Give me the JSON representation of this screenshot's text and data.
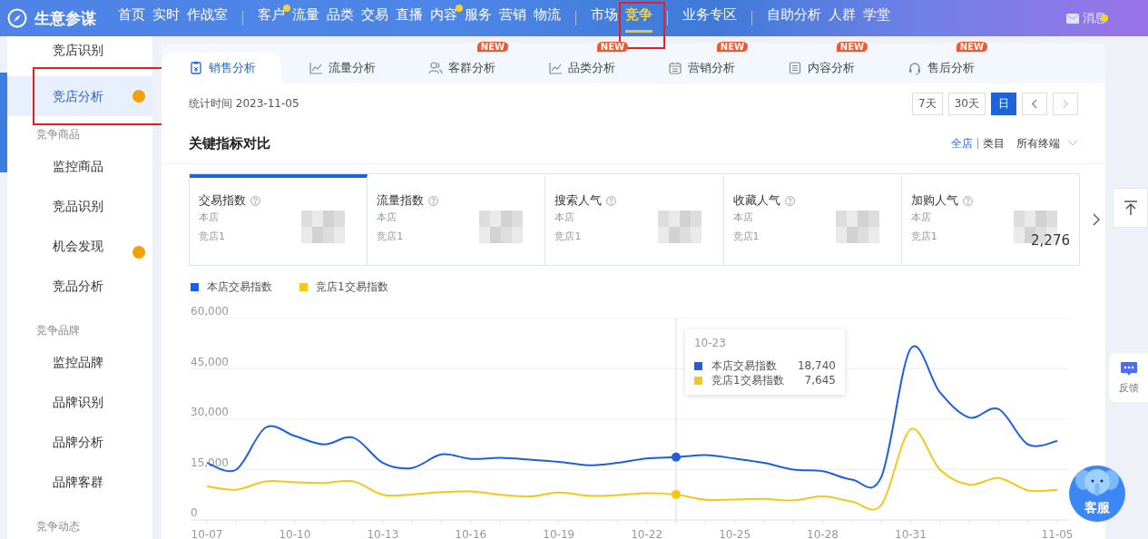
{
  "app": {
    "title": "生意参谋"
  },
  "nav": [
    {
      "items": [
        {
          "label": "首页",
          "selected": false,
          "dot": false
        },
        {
          "label": "实时",
          "selected": false,
          "dot": false
        },
        {
          "label": "作战室",
          "selected": false,
          "dot": false
        }
      ]
    },
    {
      "items": [
        {
          "label": "客户",
          "selected": false,
          "dot": true
        },
        {
          "label": "流量",
          "selected": false,
          "dot": false
        },
        {
          "label": "品类",
          "selected": false,
          "dot": false
        },
        {
          "label": "交易",
          "selected": false,
          "dot": false
        },
        {
          "label": "直播",
          "selected": false,
          "dot": false
        },
        {
          "label": "内容",
          "selected": false,
          "dot": true
        },
        {
          "label": "服务",
          "selected": false,
          "dot": false
        },
        {
          "label": "营销",
          "selected": false,
          "dot": false
        },
        {
          "label": "物流",
          "selected": false,
          "dot": false
        }
      ]
    },
    {
      "items": [
        {
          "label": "市场",
          "selected": false,
          "dot": false
        },
        {
          "label": "竞争",
          "selected": true,
          "dot": false,
          "annotated": true
        }
      ]
    },
    {
      "items": [
        {
          "label": "业务专区",
          "selected": false,
          "dot": false
        }
      ]
    },
    {
      "items": [
        {
          "label": "自助分析",
          "selected": false,
          "dot": false
        },
        {
          "label": "人群",
          "selected": false,
          "dot": false
        },
        {
          "label": "学堂",
          "selected": false,
          "dot": false
        }
      ]
    }
  ],
  "messages": {
    "label": "消息",
    "dot": true
  },
  "sidebar": [
    {
      "kind": "item",
      "label": "竞店识别",
      "selected": false,
      "dot": false
    },
    {
      "kind": "item",
      "label": "竞店分析",
      "selected": true,
      "dot": true,
      "annotated": true
    },
    {
      "kind": "section",
      "label": "竞争商品"
    },
    {
      "kind": "item",
      "label": "监控商品",
      "selected": false,
      "dot": false
    },
    {
      "kind": "item",
      "label": "竞品识别",
      "selected": false,
      "dot": false
    },
    {
      "kind": "item",
      "label": "机会发现",
      "selected": false,
      "dot": true
    },
    {
      "kind": "item",
      "label": "竞品分析",
      "selected": false,
      "dot": false
    },
    {
      "kind": "section",
      "label": "竞争品牌"
    },
    {
      "kind": "item",
      "label": "监控品牌",
      "selected": false,
      "dot": false
    },
    {
      "kind": "item",
      "label": "品牌识别",
      "selected": false,
      "dot": false
    },
    {
      "kind": "item",
      "label": "品牌分析",
      "selected": false,
      "dot": false
    },
    {
      "kind": "item",
      "label": "品牌客群",
      "selected": false,
      "dot": false
    },
    {
      "kind": "section",
      "label": "竞争动态"
    }
  ],
  "tabs": [
    {
      "label": "销售分析",
      "selected": true
    },
    {
      "label": "流量分析",
      "selected": false
    },
    {
      "label": "客群分析",
      "selected": false,
      "badge": "NEW"
    },
    {
      "label": "品类分析",
      "selected": false,
      "badge": "NEW"
    },
    {
      "label": "营销分析",
      "selected": false,
      "badge": "NEW"
    },
    {
      "label": "内容分析",
      "selected": false,
      "badge": "NEW"
    },
    {
      "label": "售后分析",
      "selected": false,
      "badge": "NEW"
    }
  ],
  "stat_time": "统计时间 2023-11-05",
  "period_buttons": [
    {
      "label": "7天",
      "selected": false
    },
    {
      "label": "30天",
      "selected": false
    },
    {
      "label": "日",
      "selected": true
    }
  ],
  "section_title": "关键指标对比",
  "scope": [
    {
      "label": "全店",
      "selected": true
    },
    {
      "label": "类目",
      "selected": false
    }
  ],
  "terminal": "所有终端",
  "metrics": [
    {
      "title": "交易指数",
      "selected": true,
      "row_a": "本店",
      "row_b": "竞店1"
    },
    {
      "title": "流量指数",
      "selected": false,
      "row_a": "本店",
      "row_b": "竞店1"
    },
    {
      "title": "搜索人气",
      "selected": false,
      "row_a": "本店",
      "row_b": "竞店1"
    },
    {
      "title": "收藏人气",
      "selected": false,
      "row_a": "本店",
      "row_b": "竞店1"
    },
    {
      "title": "加购人气",
      "selected": false,
      "row_a": "本店",
      "row_b": "竞店1",
      "value_b": "2,276"
    }
  ],
  "chart_data": {
    "type": "line",
    "legend": "top-left",
    "grid": true,
    "categories": [
      "10-07",
      null,
      null,
      "10-10",
      null,
      null,
      "10-13",
      null,
      null,
      "10-16",
      null,
      null,
      "10-19",
      null,
      null,
      "10-22",
      null,
      null,
      "10-25",
      null,
      null,
      "10-28",
      null,
      null,
      "10-31",
      null,
      null,
      null,
      null,
      "11-05"
    ],
    "ylim": [
      0,
      60000
    ],
    "yticks": [
      {
        "value": 0,
        "label": "0"
      },
      {
        "value": 15000,
        "label": "15,000"
      },
      {
        "value": 30000,
        "label": "30,000"
      },
      {
        "value": 45000,
        "label": "45,000"
      },
      {
        "value": 60000,
        "label": "60,000"
      }
    ],
    "series": [
      {
        "name": "本店交易指数",
        "color": "#1d5fe0",
        "values": [
          17000,
          15000,
          27500,
          25000,
          22500,
          24500,
          17000,
          15500,
          19500,
          18200,
          18500,
          18000,
          17300,
          16300,
          17000,
          18300,
          18700,
          19300,
          18300,
          17000,
          15000,
          14500,
          12000,
          12800,
          51000,
          38000,
          30500,
          33000,
          22500,
          23500
        ]
      },
      {
        "name": "竞店1交易指数",
        "color": "#f2c81b",
        "values": [
          10000,
          9000,
          11500,
          11200,
          11000,
          11500,
          7500,
          7600,
          8300,
          8500,
          7500,
          7000,
          8200,
          7200,
          7400,
          8000,
          7600,
          6000,
          6100,
          6300,
          5800,
          7000,
          5500,
          4500,
          27000,
          15000,
          10500,
          12500,
          8800,
          9000
        ]
      }
    ],
    "stacked": false
  },
  "tooltip": {
    "title": "10-23",
    "days": [
      {
        "selected": false
      },
      {
        "selected": false
      },
      {
        "selected": false
      },
      {
        "selected": false
      },
      {
        "selected": false
      },
      {
        "selected": false
      },
      {
        "selected": false
      },
      {
        "selected": false
      },
      {
        "selected": false
      },
      {
        "selected": false
      },
      {
        "selected": false
      },
      {
        "selected": false
      },
      {
        "selected": false
      },
      {
        "selected": false
      },
      {
        "selected": false
      },
      {
        "selected": false
      },
      {
        "selected": true
      },
      {
        "selected": false
      },
      {
        "selected": false
      },
      {
        "selected": false
      },
      {
        "selected": false
      },
      {
        "selected": false
      },
      {
        "selected": false
      },
      {
        "selected": false
      },
      {
        "selected": false
      },
      {
        "selected": false
      },
      {
        "selected": false
      },
      {
        "selected": false
      },
      {
        "selected": false
      },
      {
        "selected": false
      }
    ],
    "rows": [
      {
        "name": "本店交易指数",
        "value": "18,740",
        "color": "#1d5fe0"
      },
      {
        "name": "竞店1交易指数",
        "value": "7,645",
        "color": "#f2c81b"
      }
    ]
  },
  "float": {
    "feedback": "反馈",
    "service": "客服"
  }
}
